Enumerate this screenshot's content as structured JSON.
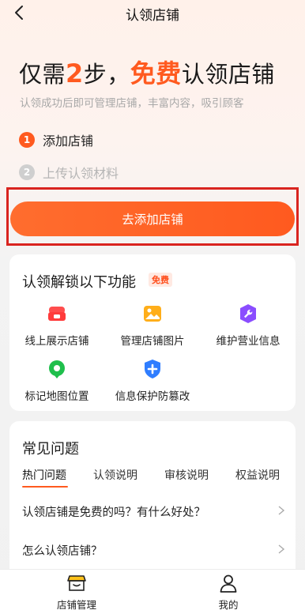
{
  "header": {
    "title": "认领店铺"
  },
  "hero": {
    "title_prefix": "仅需",
    "title_num": "2",
    "title_mid": "步，",
    "title_free": "免费",
    "title_suffix": "认领店铺",
    "subtitle": "认领成功后即可管理店铺，丰富内容，吸引顾客"
  },
  "steps": [
    {
      "num": "1",
      "label": "添加店铺"
    },
    {
      "num": "2",
      "label": "上传认领材料"
    }
  ],
  "cta": {
    "label": "去添加店铺"
  },
  "features": {
    "title": "认领解锁以下功能",
    "badge": "免费",
    "items": [
      {
        "label": "线上展示店铺",
        "icon": "store-display-icon"
      },
      {
        "label": "管理店铺图片",
        "icon": "image-icon"
      },
      {
        "label": "维护营业信息",
        "icon": "wrench-icon"
      },
      {
        "label": "标记地图位置",
        "icon": "map-pin-icon"
      },
      {
        "label": "信息保护防篡改",
        "icon": "shield-plus-icon"
      }
    ]
  },
  "faq": {
    "title": "常见问题",
    "tabs": [
      "热门问题",
      "认领说明",
      "审核说明",
      "权益说明"
    ],
    "items": [
      "认领店铺是免费的吗？有什么好处？",
      "怎么认领店铺？"
    ]
  },
  "bottom_nav": {
    "items": [
      {
        "label": "店铺管理",
        "icon": "shop-icon"
      },
      {
        "label": "我的",
        "icon": "person-icon"
      }
    ]
  },
  "colors": {
    "accent": "#ff5a1f",
    "highlight_border": "#d9241f"
  }
}
